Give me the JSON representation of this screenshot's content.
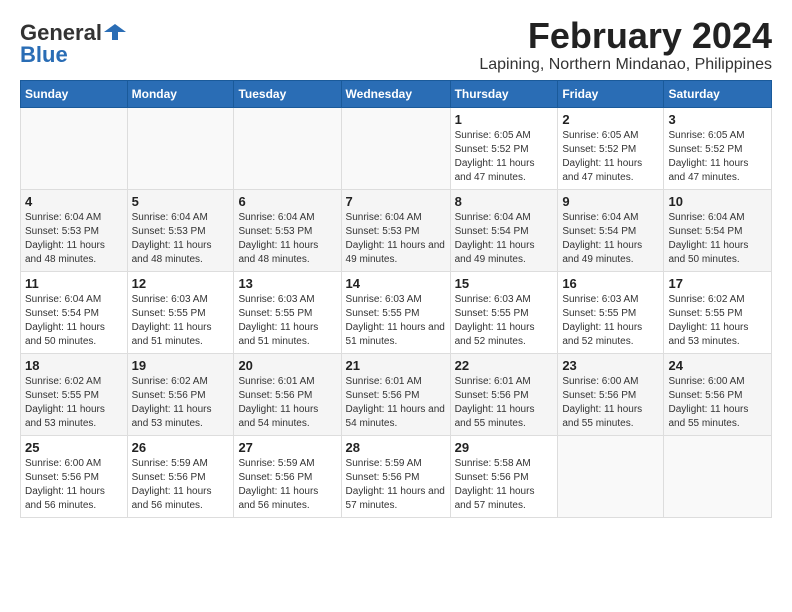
{
  "logo": {
    "general": "General",
    "blue": "Blue"
  },
  "title": "February 2024",
  "subtitle": "Lapining, Northern Mindanao, Philippines",
  "days_of_week": [
    "Sunday",
    "Monday",
    "Tuesday",
    "Wednesday",
    "Thursday",
    "Friday",
    "Saturday"
  ],
  "weeks": [
    [
      {
        "day": "",
        "info": ""
      },
      {
        "day": "",
        "info": ""
      },
      {
        "day": "",
        "info": ""
      },
      {
        "day": "",
        "info": ""
      },
      {
        "day": "1",
        "info": "Sunrise: 6:05 AM\nSunset: 5:52 PM\nDaylight: 11 hours and 47 minutes."
      },
      {
        "day": "2",
        "info": "Sunrise: 6:05 AM\nSunset: 5:52 PM\nDaylight: 11 hours and 47 minutes."
      },
      {
        "day": "3",
        "info": "Sunrise: 6:05 AM\nSunset: 5:52 PM\nDaylight: 11 hours and 47 minutes."
      }
    ],
    [
      {
        "day": "4",
        "info": "Sunrise: 6:04 AM\nSunset: 5:53 PM\nDaylight: 11 hours and 48 minutes."
      },
      {
        "day": "5",
        "info": "Sunrise: 6:04 AM\nSunset: 5:53 PM\nDaylight: 11 hours and 48 minutes."
      },
      {
        "day": "6",
        "info": "Sunrise: 6:04 AM\nSunset: 5:53 PM\nDaylight: 11 hours and 48 minutes."
      },
      {
        "day": "7",
        "info": "Sunrise: 6:04 AM\nSunset: 5:53 PM\nDaylight: 11 hours and 49 minutes."
      },
      {
        "day": "8",
        "info": "Sunrise: 6:04 AM\nSunset: 5:54 PM\nDaylight: 11 hours and 49 minutes."
      },
      {
        "day": "9",
        "info": "Sunrise: 6:04 AM\nSunset: 5:54 PM\nDaylight: 11 hours and 49 minutes."
      },
      {
        "day": "10",
        "info": "Sunrise: 6:04 AM\nSunset: 5:54 PM\nDaylight: 11 hours and 50 minutes."
      }
    ],
    [
      {
        "day": "11",
        "info": "Sunrise: 6:04 AM\nSunset: 5:54 PM\nDaylight: 11 hours and 50 minutes."
      },
      {
        "day": "12",
        "info": "Sunrise: 6:03 AM\nSunset: 5:55 PM\nDaylight: 11 hours and 51 minutes."
      },
      {
        "day": "13",
        "info": "Sunrise: 6:03 AM\nSunset: 5:55 PM\nDaylight: 11 hours and 51 minutes."
      },
      {
        "day": "14",
        "info": "Sunrise: 6:03 AM\nSunset: 5:55 PM\nDaylight: 11 hours and 51 minutes."
      },
      {
        "day": "15",
        "info": "Sunrise: 6:03 AM\nSunset: 5:55 PM\nDaylight: 11 hours and 52 minutes."
      },
      {
        "day": "16",
        "info": "Sunrise: 6:03 AM\nSunset: 5:55 PM\nDaylight: 11 hours and 52 minutes."
      },
      {
        "day": "17",
        "info": "Sunrise: 6:02 AM\nSunset: 5:55 PM\nDaylight: 11 hours and 53 minutes."
      }
    ],
    [
      {
        "day": "18",
        "info": "Sunrise: 6:02 AM\nSunset: 5:55 PM\nDaylight: 11 hours and 53 minutes."
      },
      {
        "day": "19",
        "info": "Sunrise: 6:02 AM\nSunset: 5:56 PM\nDaylight: 11 hours and 53 minutes."
      },
      {
        "day": "20",
        "info": "Sunrise: 6:01 AM\nSunset: 5:56 PM\nDaylight: 11 hours and 54 minutes."
      },
      {
        "day": "21",
        "info": "Sunrise: 6:01 AM\nSunset: 5:56 PM\nDaylight: 11 hours and 54 minutes."
      },
      {
        "day": "22",
        "info": "Sunrise: 6:01 AM\nSunset: 5:56 PM\nDaylight: 11 hours and 55 minutes."
      },
      {
        "day": "23",
        "info": "Sunrise: 6:00 AM\nSunset: 5:56 PM\nDaylight: 11 hours and 55 minutes."
      },
      {
        "day": "24",
        "info": "Sunrise: 6:00 AM\nSunset: 5:56 PM\nDaylight: 11 hours and 55 minutes."
      }
    ],
    [
      {
        "day": "25",
        "info": "Sunrise: 6:00 AM\nSunset: 5:56 PM\nDaylight: 11 hours and 56 minutes."
      },
      {
        "day": "26",
        "info": "Sunrise: 5:59 AM\nSunset: 5:56 PM\nDaylight: 11 hours and 56 minutes."
      },
      {
        "day": "27",
        "info": "Sunrise: 5:59 AM\nSunset: 5:56 PM\nDaylight: 11 hours and 56 minutes."
      },
      {
        "day": "28",
        "info": "Sunrise: 5:59 AM\nSunset: 5:56 PM\nDaylight: 11 hours and 57 minutes."
      },
      {
        "day": "29",
        "info": "Sunrise: 5:58 AM\nSunset: 5:56 PM\nDaylight: 11 hours and 57 minutes."
      },
      {
        "day": "",
        "info": ""
      },
      {
        "day": "",
        "info": ""
      }
    ]
  ]
}
